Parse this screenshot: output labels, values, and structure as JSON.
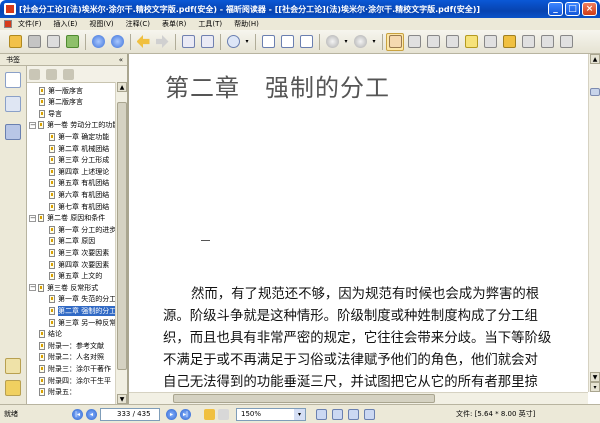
{
  "window": {
    "title": "[社会分工论](法)埃米尔·涂尔干.精校文字版.pdf(安全) - 福昕阅读器 - [[社会分工论](法)埃米尔·涂尔干.精校文字版.pdf(安全)]",
    "min": "_",
    "max": "□",
    "close": "×"
  },
  "menu": [
    {
      "label": "文件(F)"
    },
    {
      "label": "插入(E)"
    },
    {
      "label": "视图(V)"
    },
    {
      "label": "注释(C)"
    },
    {
      "label": "表单(R)"
    },
    {
      "label": "工具(T)"
    },
    {
      "label": "帮助(H)"
    }
  ],
  "sidebar": {
    "title": "书签",
    "pin": "«"
  },
  "bookmarks": [
    {
      "label": "第一版序言",
      "level": 1
    },
    {
      "label": "第二版序言",
      "level": 1
    },
    {
      "label": "导言",
      "level": 1
    },
    {
      "label": "第一卷 劳动分工的功能",
      "level": 0
    },
    {
      "label": "第一章 确定功能",
      "level": 2
    },
    {
      "label": "第二章 机械团结",
      "level": 2
    },
    {
      "label": "第三章 分工形成",
      "level": 2
    },
    {
      "label": "第四章 上述理论",
      "level": 2
    },
    {
      "label": "第五章 有机团结",
      "level": 2
    },
    {
      "label": "第六章 有机团结",
      "level": 2
    },
    {
      "label": "第七章 有机团结",
      "level": 2
    },
    {
      "label": "第二卷 原因和条件",
      "level": 0
    },
    {
      "label": "第一章 分工的进步",
      "level": 2
    },
    {
      "label": "第二章 原因",
      "level": 2
    },
    {
      "label": "第三章 次要因素",
      "level": 2
    },
    {
      "label": "第四章 次要因素",
      "level": 2
    },
    {
      "label": "第五章 上文的",
      "level": 2
    },
    {
      "label": "第三卷 反常形式",
      "level": 0
    },
    {
      "label": "第一章 失范的分工",
      "level": 2
    },
    {
      "label": "第二章 强制的分工",
      "level": 2
    },
    {
      "label": "第三章 另一种反常",
      "level": 2
    },
    {
      "label": "结论",
      "level": 1
    },
    {
      "label": "附录一：参考文献",
      "level": 1
    },
    {
      "label": "附录二：人名对照",
      "level": 1
    },
    {
      "label": "附录三：涂尔干著作",
      "level": 1
    },
    {
      "label": "附录四：涂尔干生平",
      "level": 1
    },
    {
      "label": "附录五：",
      "level": 1
    }
  ],
  "document": {
    "chapter_title": "第二章　强制的分工",
    "section_mark": "一",
    "lines": [
      "然而，有了规范还不够，因为规范有时候也会成为弊害的根",
      "源。阶级斗争就是这种情形。阶级制度或种姓制度构成了分工组",
      "织，而且也具有非常严密的规定，它往往会带来分歧。当下等阶级",
      "不满足于或不再满足于习俗或法律赋予他们的角色，他们就会对",
      "自己无法得到的功能垂涎三尺，并试图把它从它的所有者那里掠"
    ]
  },
  "status": {
    "ready": "就绪",
    "page": "333 / 435",
    "zoom": "150%",
    "zoom_arrow": "▾",
    "file_info": "文件: [5.64 * 8.00 英寸]"
  }
}
